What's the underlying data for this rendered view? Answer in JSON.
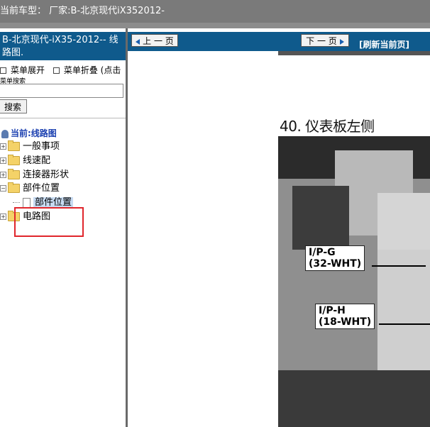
{
  "header": {
    "current_car": "当前车型：  厂家:B-北京现代iX352012-"
  },
  "left": {
    "title": "B-北京现代-iX35-2012-- 线路图.",
    "expand_label": "菜单展开",
    "collapse_label": "菜单折叠 (点击",
    "search_label": "菜单搜索",
    "search_value": "",
    "search_button": "搜索",
    "current": "当前:线路图",
    "tree": [
      {
        "label": "一般事项",
        "state": "collapsed"
      },
      {
        "label": "线速配",
        "state": "collapsed"
      },
      {
        "label": "连接器形状",
        "state": "collapsed"
      },
      {
        "label": "部件位置",
        "state": "expanded"
      },
      {
        "label": "部件位置",
        "state": "leaf",
        "selected": true
      },
      {
        "label": "电路图",
        "state": "collapsed"
      }
    ]
  },
  "right": {
    "prev_label": "上 一 页",
    "next_label": "下 一 页",
    "refresh_label": "[刷新当前页]",
    "section_title": "40. 仪表板左侧",
    "callouts": [
      {
        "line1": "I/P-G",
        "line2": "(32-WHT)"
      },
      {
        "line1": "I/P-H",
        "line2": "(18-WHT)"
      }
    ]
  },
  "colors": {
    "accent": "#0f5a8c",
    "highlight": "#e0262c",
    "selected": "#c7dbf2"
  }
}
